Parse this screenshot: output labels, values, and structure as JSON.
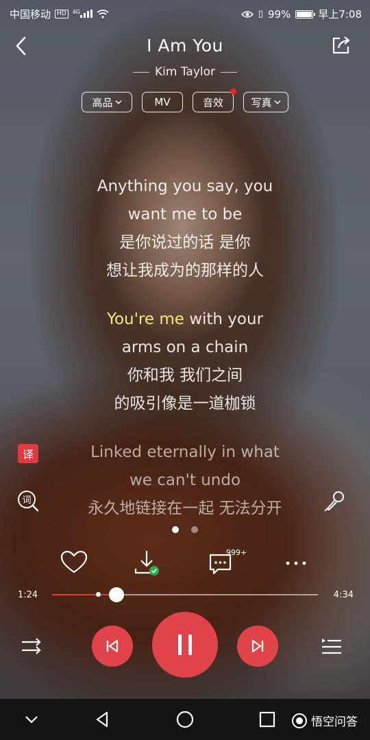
{
  "status_bar": {
    "carrier": "中国移动",
    "hd_badge": "HD",
    "network": "4G",
    "battery": "99%",
    "battery_level": 0.99,
    "time": "早上7:08"
  },
  "header": {
    "title": "I Am You",
    "artist": "Kim Taylor"
  },
  "options": [
    {
      "label": "高品",
      "has_chevron": true
    },
    {
      "label": "MV",
      "has_chevron": false
    },
    {
      "label": "音效",
      "has_red_dot": true
    },
    {
      "label": "写真",
      "has_chevron": true
    }
  ],
  "lyrics": {
    "l1a": "Anything you say, you",
    "l1b": "want me to be",
    "l1c": "是你说过的话 是你",
    "l1d": "想让我成为的那样的人",
    "l2a_sung": "You're me",
    "l2a_rest": " with your",
    "l2b": "arms on a chain",
    "l2c": "你和我 我们之间",
    "l2d": "的吸引像是一道枷锁",
    "l3a": "Linked eternally in what",
    "l3b": "we can't undo",
    "l3c": "永久地链接在一起 无法分开"
  },
  "side_buttons": {
    "translate": "译",
    "lyrics_icon": "词"
  },
  "comment_count": "999+",
  "progress": {
    "current": "1:24",
    "total": "4:34",
    "fraction": 0.242
  },
  "icons": {
    "back": "chevron-left-icon",
    "share": "share-icon",
    "heart": "heart-icon",
    "download": "download-icon",
    "comment": "comment-icon",
    "more": "more-icon",
    "shuffle": "shuffle-icon",
    "prev": "previous-icon",
    "pause": "pause-icon",
    "next": "next-icon",
    "playlist": "playlist-icon",
    "mic": "microphone-icon"
  },
  "navbar": {
    "brand_text": "悟空问答"
  },
  "colors": {
    "accent": "#e0444a",
    "highlight": "#f3e97c"
  }
}
